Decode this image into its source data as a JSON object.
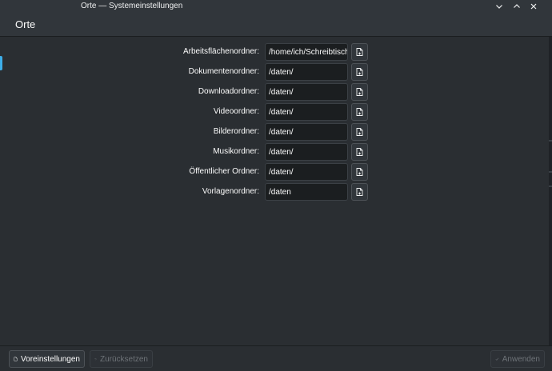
{
  "window": {
    "title": "Orte — Systemeinstellungen"
  },
  "header": {
    "title": "Orte"
  },
  "rows": [
    {
      "label": "Arbeitsflächenordner:",
      "value": "/home/ich/Schreibtisch"
    },
    {
      "label": "Dokumentenordner:",
      "value": "/daten/"
    },
    {
      "label": "Downloadordner:",
      "value": "/daten/"
    },
    {
      "label": "Videoordner:",
      "value": "/daten/"
    },
    {
      "label": "Bilderordner:",
      "value": "/daten/"
    },
    {
      "label": "Musikordner:",
      "value": "/daten/"
    },
    {
      "label": "Öffentlicher Ordner:",
      "value": "/daten/"
    },
    {
      "label": "Vorlagenordner:",
      "value": "/daten"
    }
  ],
  "footer": {
    "defaults_label": "Voreinstellungen",
    "reset_label": "Zurücksetzen",
    "apply_label": "Anwenden"
  },
  "colors": {
    "accent": "#3daee9",
    "background": "#2a2e32",
    "field_background": "#1b1e20",
    "disabled_text": "#6e7378"
  },
  "icons": {
    "window_buttons": [
      "chevron-down-icon",
      "chevron-up-icon",
      "close-icon"
    ],
    "browse": "document-open-icon",
    "defaults": "document-icon",
    "reset": "undo-icon",
    "apply": "checkmark-icon"
  }
}
